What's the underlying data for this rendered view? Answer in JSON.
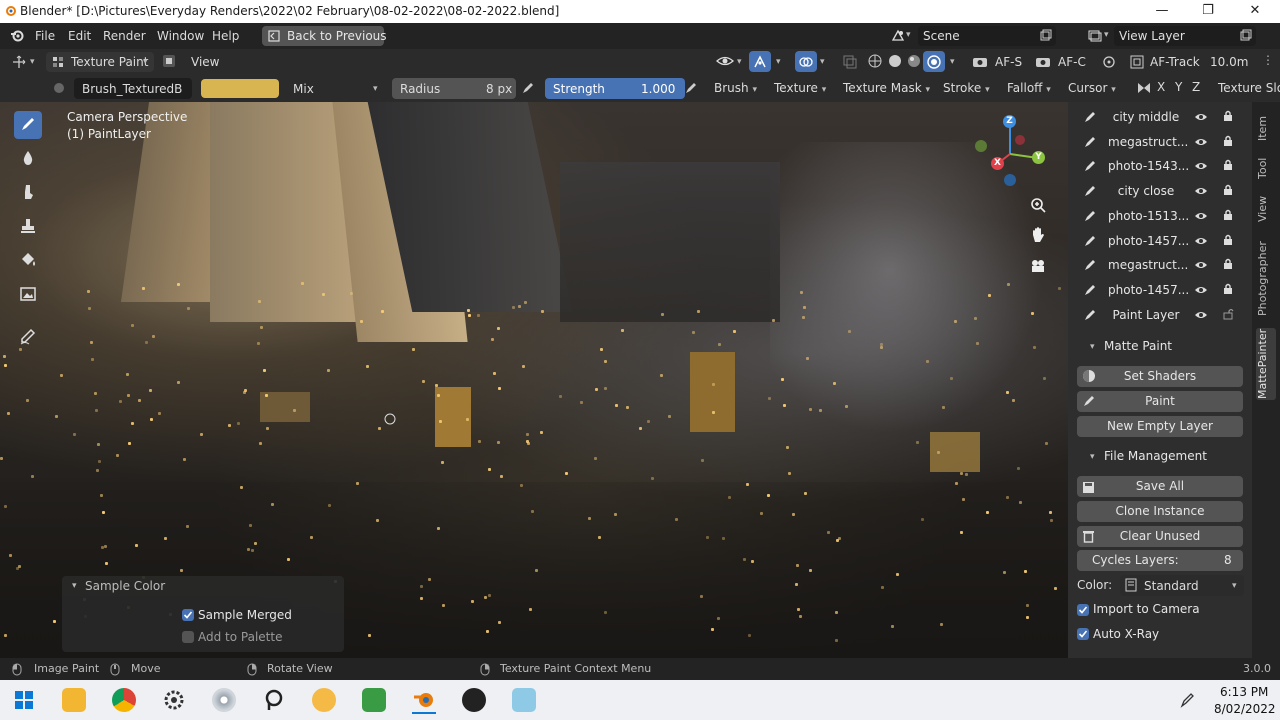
{
  "window": {
    "title": "Blender* [D:\\Pictures\\Everyday Renders\\2022\\02 February\\08-02-2022\\08-02-2022.blend]",
    "minimize": "—",
    "maximize": "❐",
    "close": "✕"
  },
  "menubar": {
    "items": [
      "File",
      "Edit",
      "Render",
      "Window",
      "Help"
    ],
    "back_button": "Back to Previous",
    "scene_label": "Scene",
    "view_layer_label": "View Layer"
  },
  "header1": {
    "mode": "Texture Paint",
    "view_menu": "View",
    "af_s": "AF-S",
    "af_c": "AF-C",
    "af_track": "AF-Track",
    "distance": "10.0m"
  },
  "header2": {
    "brush_name": "Brush_TexturedB",
    "brush_color": "#d9b552",
    "blend_mode": "Mix",
    "radius_label": "Radius",
    "radius_value": "8 px",
    "strength_label": "Strength",
    "strength_value": "1.000",
    "menus": [
      "Brush",
      "Texture",
      "Texture Mask",
      "Stroke",
      "Falloff",
      "Cursor"
    ],
    "axes": [
      "X",
      "Y",
      "Z"
    ],
    "texture_slots": "Texture Slo"
  },
  "viewport": {
    "camera_label": "Camera Perspective",
    "layer_label": "(1) PaintLayer"
  },
  "gizmo": {
    "z": "Z",
    "y": "Y",
    "x": "X"
  },
  "sample_panel": {
    "title": "Sample Color",
    "sample_merged": "Sample Merged",
    "sample_merged_checked": true,
    "add_to_palette": "Add to Palette",
    "add_to_palette_checked": false
  },
  "sidebar": {
    "layers": [
      {
        "name": "city middle",
        "locked": true
      },
      {
        "name": "megastruct...",
        "locked": true
      },
      {
        "name": "photo-1543...",
        "locked": true
      },
      {
        "name": "city close",
        "locked": true
      },
      {
        "name": "photo-1513...",
        "locked": true
      },
      {
        "name": "photo-1457...",
        "locked": true
      },
      {
        "name": "megastruct...",
        "locked": true
      },
      {
        "name": "photo-1457...",
        "locked": true
      },
      {
        "name": "Paint Layer",
        "locked": false
      }
    ],
    "matte_paint_title": "Matte Paint",
    "set_shaders": "Set Shaders",
    "paint": "Paint",
    "new_empty_layer": "New Empty Layer",
    "file_management_title": "File Management",
    "save_all": "Save All",
    "clone_instance": "Clone Instance",
    "clear_unused": "Clear Unused",
    "cycles_layers_label": "Cycles Layers:",
    "cycles_layers_value": "8",
    "color_label": "Color:",
    "color_value": "Standard",
    "import_to_camera": "Import to Camera",
    "import_to_camera_checked": true,
    "auto_xray": "Auto X-Ray",
    "auto_xray_checked": true
  },
  "side_tabs": [
    "Item",
    "Tool",
    "View",
    "Photographer",
    "MattePainter"
  ],
  "statusbar": {
    "image_paint": "Image Paint",
    "move": "Move",
    "rotate_view": "Rotate View",
    "context_menu": "Texture Paint Context Menu",
    "version": "3.0.0"
  },
  "taskbar": {
    "time": "6:13 PM",
    "date": "8/02/2022",
    "apps": [
      "windows-start",
      "file-explorer",
      "chrome",
      "settings",
      "disk",
      "search-p",
      "vlc-like",
      "green-app",
      "blender",
      "unity",
      "notes"
    ]
  },
  "colors": {
    "accent": "#4772b3",
    "axis_x": "#e0414b",
    "axis_y": "#8bc43f",
    "axis_z": "#3f8fe0"
  }
}
